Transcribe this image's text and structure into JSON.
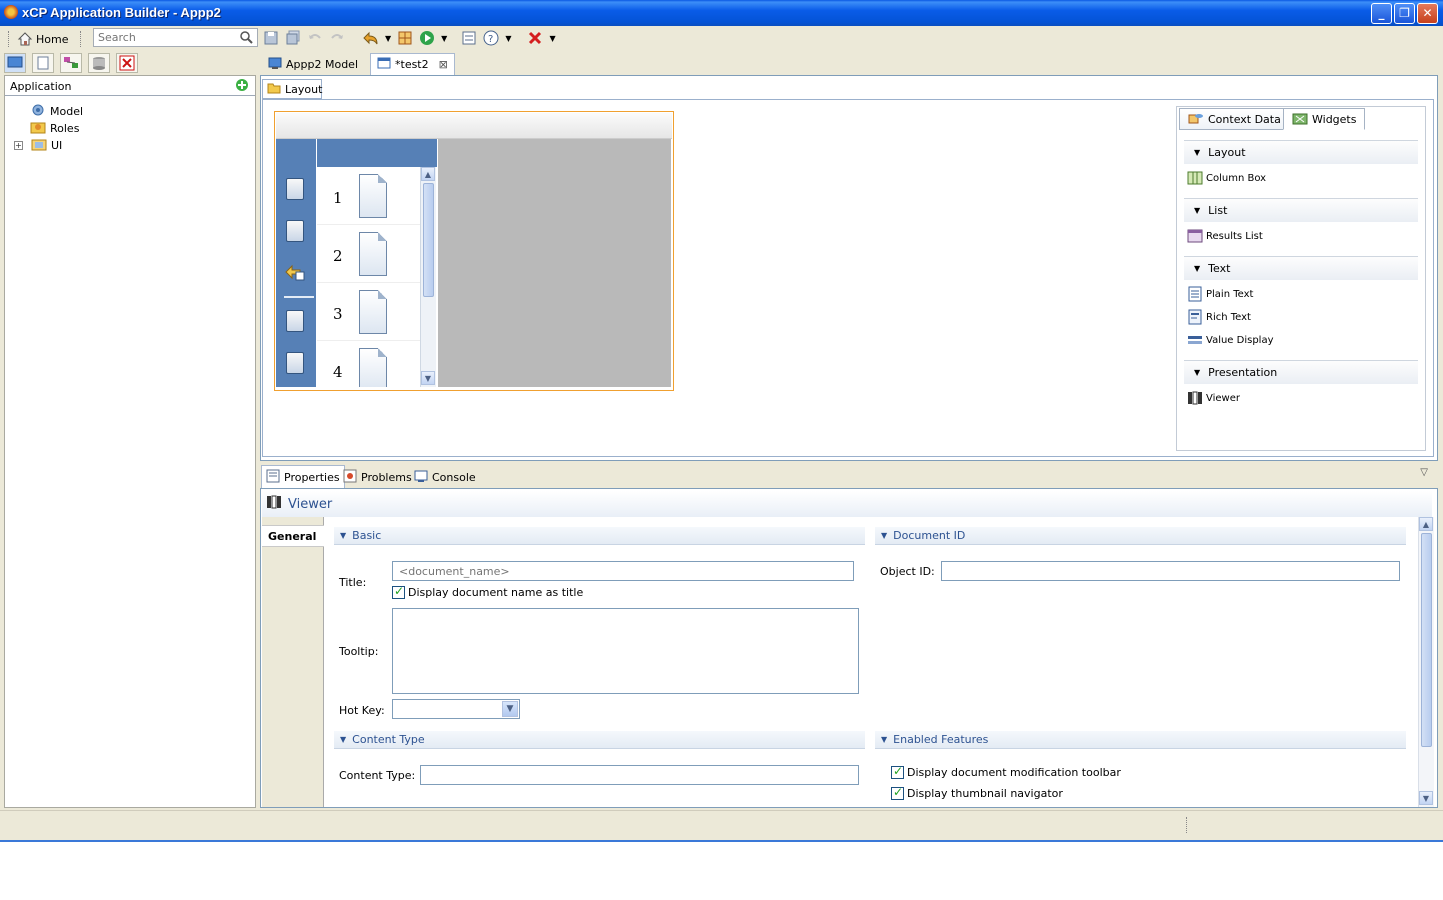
{
  "window": {
    "title": "xCP Application Builder - Appp2"
  },
  "toolbar": {
    "home_label": "Home",
    "search_placeholder": "Search"
  },
  "left_panel": {
    "header": "Application",
    "tree": [
      {
        "label": "Model"
      },
      {
        "label": "Roles"
      },
      {
        "label": "UI"
      }
    ]
  },
  "editor": {
    "tabs": [
      {
        "label": "Appp2 Model"
      },
      {
        "label": "*test2"
      }
    ],
    "sub_tab": "Layout",
    "viewer_preview": {
      "thumbnails": [
        "1",
        "2",
        "3",
        "4"
      ]
    }
  },
  "palette": {
    "tabs": [
      {
        "label": "Context Data"
      },
      {
        "label": "Widgets"
      }
    ],
    "sections": [
      {
        "title": "Layout",
        "items": [
          "Column Box"
        ]
      },
      {
        "title": "List",
        "items": [
          "Results List"
        ]
      },
      {
        "title": "Text",
        "items": [
          "Plain Text",
          "Rich Text",
          "Value Display"
        ]
      },
      {
        "title": "Presentation",
        "items": [
          "Viewer"
        ]
      }
    ]
  },
  "bottom": {
    "tabs": [
      {
        "label": "Properties"
      },
      {
        "label": "Problems"
      },
      {
        "label": "Console"
      }
    ],
    "widget_title": "Viewer",
    "side_tab": "General",
    "basic": {
      "header": "Basic",
      "title_label": "Title:",
      "title_placeholder": "<document_name>",
      "display_name_check": "Display document name as title",
      "tooltip_label": "Tooltip:",
      "hotkey_label": "Hot Key:"
    },
    "document_id": {
      "header": "Document ID",
      "object_id_label": "Object ID:"
    },
    "content_type": {
      "header": "Content Type",
      "label": "Content Type:"
    },
    "enabled_features": {
      "header": "Enabled Features",
      "toolbar_check": "Display document modification toolbar",
      "thumbnail_check": "Display thumbnail navigator"
    }
  }
}
